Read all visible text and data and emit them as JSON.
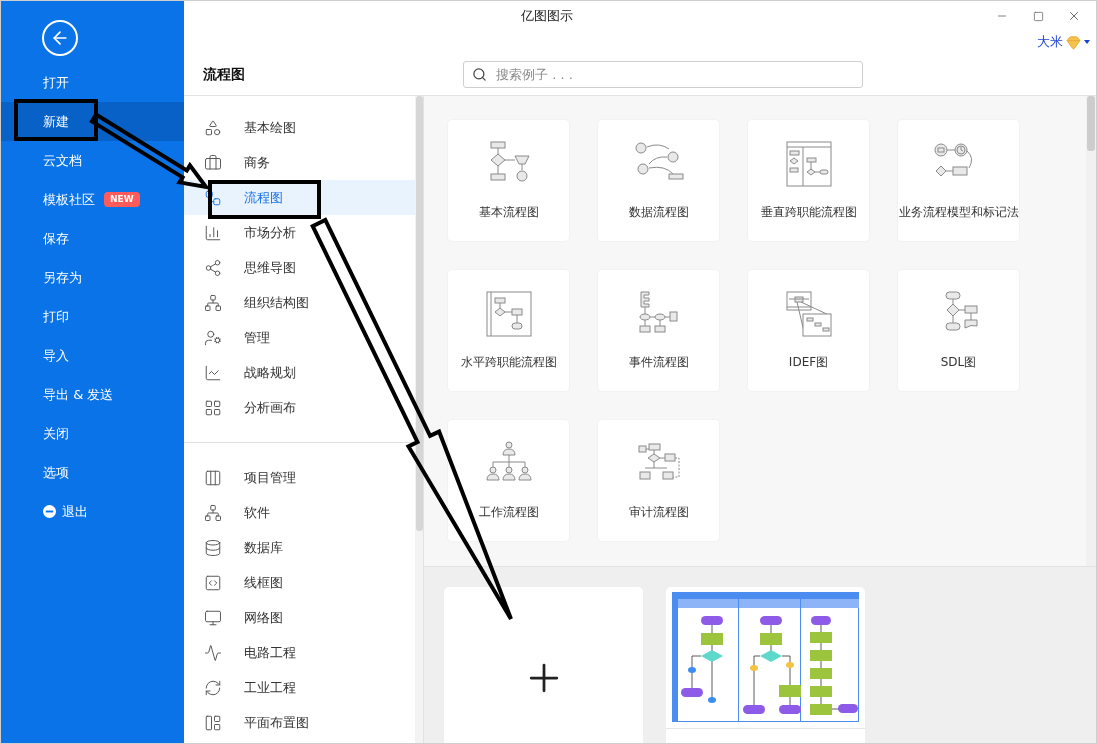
{
  "window": {
    "title": "亿图图示"
  },
  "user": {
    "name": "大米"
  },
  "sidebar": {
    "items": [
      {
        "label": "打开",
        "kind": "item",
        "selected": false
      },
      {
        "label": "新建",
        "kind": "item",
        "selected": true
      },
      {
        "label": "云文档",
        "kind": "item",
        "selected": false
      },
      {
        "label": "模板社区",
        "kind": "item",
        "selected": false,
        "badge": "NEW"
      },
      {
        "label": "保存",
        "kind": "item",
        "selected": false
      },
      {
        "label": "另存为",
        "kind": "item",
        "selected": false
      },
      {
        "label": "打印",
        "kind": "item",
        "selected": false
      },
      {
        "label": "导入",
        "kind": "item",
        "selected": false
      },
      {
        "label": "导出 & 发送",
        "kind": "item",
        "selected": false
      },
      {
        "label": "关闭",
        "kind": "item",
        "selected": false
      },
      {
        "label": "选项",
        "kind": "item",
        "selected": false
      },
      {
        "label": "退出",
        "kind": "exit",
        "selected": false
      }
    ]
  },
  "header": {
    "title": "流程图",
    "search": {
      "placeholder": "搜索例子 . . ."
    }
  },
  "categories": {
    "groups": [
      {
        "items": [
          {
            "label": "基本绘图",
            "selected": false
          },
          {
            "label": "商务",
            "selected": false
          },
          {
            "label": "流程图",
            "selected": true
          },
          {
            "label": "市场分析",
            "selected": false
          },
          {
            "label": "思维导图",
            "selected": false
          },
          {
            "label": "组织结构图",
            "selected": false
          },
          {
            "label": "管理",
            "selected": false
          },
          {
            "label": "战略规划",
            "selected": false
          },
          {
            "label": "分析画布",
            "selected": false
          }
        ]
      },
      {
        "items": [
          {
            "label": "项目管理",
            "selected": false
          },
          {
            "label": "软件",
            "selected": false
          },
          {
            "label": "数据库",
            "selected": false
          },
          {
            "label": "线框图",
            "selected": false
          },
          {
            "label": "网络图",
            "selected": false
          },
          {
            "label": "电路工程",
            "selected": false
          },
          {
            "label": "工业工程",
            "selected": false
          },
          {
            "label": "平面布置图",
            "selected": false
          }
        ]
      }
    ]
  },
  "templates": [
    {
      "label": "基本流程图"
    },
    {
      "label": "数据流程图"
    },
    {
      "label": "垂直跨职能流程图"
    },
    {
      "label": "业务流程模型和标记法"
    },
    {
      "label": "水平跨职能流程图"
    },
    {
      "label": "事件流程图"
    },
    {
      "label": "IDEF图"
    },
    {
      "label": "SDL图"
    },
    {
      "label": "工作流程图"
    },
    {
      "label": "审计流程图"
    }
  ],
  "examples": [
    {
      "kind": "blank"
    },
    {
      "kind": "template"
    }
  ]
}
